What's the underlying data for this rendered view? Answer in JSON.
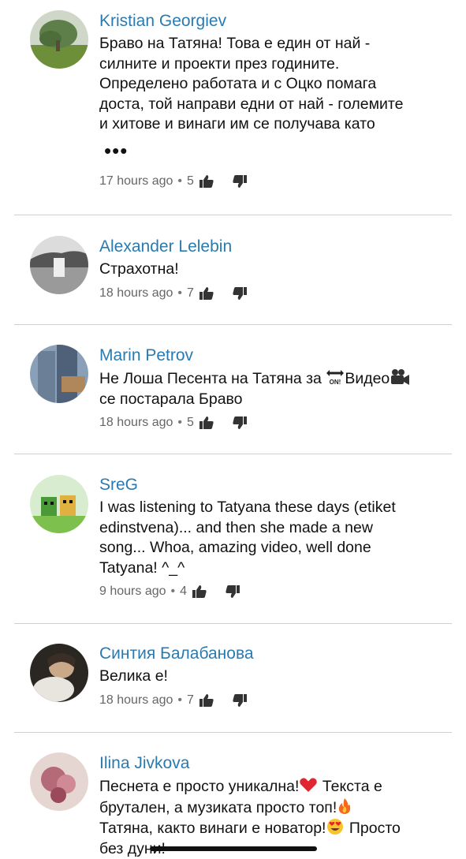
{
  "comments": [
    {
      "author": "Kristian Georgiev",
      "lines": [
        "Браво на Татяна! Това е един от най -",
        "силните и проекти през годините.",
        "Определено работата и с Оцко помага",
        "доста, той направи едни от най - големите",
        "и хитове и винаги им се получава като"
      ],
      "more": "•••",
      "time": "17 hours ago",
      "sep": "•",
      "likes": "5"
    },
    {
      "author": "Alexander Lelebin",
      "lines": [
        "Страхотна!"
      ],
      "time": "18 hours ago",
      "sep": "•",
      "likes": "7"
    },
    {
      "author": "Marin Petrov",
      "line1_a": "Не Лоша Песента на Татяна за ",
      "line1_b": "Видео",
      "line2": "се постарала Браво",
      "emoji_on": "ON!",
      "time": "18 hours ago",
      "sep": "•",
      "likes": "5"
    },
    {
      "author": "SreG",
      "lines": [
        "I was listening to Tatyana these days (etiket",
        "edinstvena)... and then she made a new",
        "song... Whoa, amazing video, well done",
        "Tatyana! ^_^"
      ],
      "time": "9 hours ago",
      "sep": "•",
      "likes": "4"
    },
    {
      "author": "Синтия Балабанова",
      "lines": [
        "Велика е!"
      ],
      "time": "18 hours ago",
      "sep": "•",
      "likes": "7"
    },
    {
      "author": "Ilina Jivkova",
      "line1": "Песнета е просто уникална!",
      "line1_b": " Текста е",
      "line2": "брутален, а музиката просто топ!",
      "line3": "Татяна, както винаги е новатор!",
      "line3_b": " Просто",
      "line4": "без дуни!"
    }
  ],
  "icons": {
    "like": "thumbs-up-icon",
    "dislike": "thumbs-down-icon",
    "heart": "red-heart-emoji",
    "fire": "fire-emoji",
    "hearteyes": "heart-eyes-emoji",
    "arrow": "on-arrow-emoji",
    "camera": "movie-camera-emoji"
  },
  "colors": {
    "author": "#2a7ab0",
    "text": "#111111",
    "meta": "#666666",
    "divider": "#cfcfcf"
  }
}
